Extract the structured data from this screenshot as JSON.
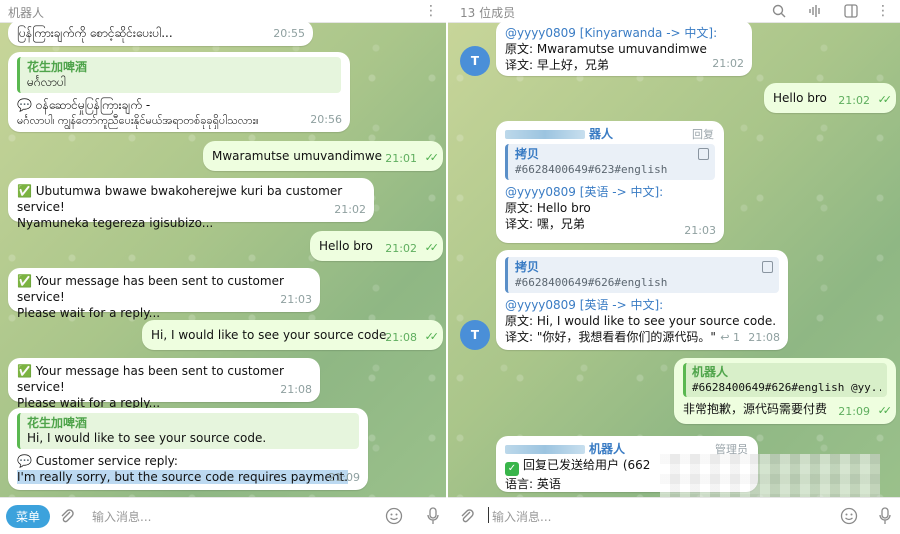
{
  "left": {
    "header": {
      "title": "机器人"
    },
    "messages": {
      "m0": {
        "text": "ပြန်ကြားချက်ကို စောင့်ဆိုင်းပေးပါ...",
        "time": "20:55"
      },
      "m1": {
        "quote_name": "花生加啤酒",
        "quote_text": "မင်္ဂလာပါ",
        "line1": "💬 ဝန်ဆောင်မှုပြန်ကြားချက် -",
        "line2": "မင်္ဂလာပါ၊ ကျွန်တော်ကူညီပေးနိုင်မယ်အရာတစ်ခုခုရှိပါသလား။",
        "time": "20:56"
      },
      "m2": {
        "text": "Mwaramutse umuvandimwe",
        "time": "21:01"
      },
      "m3": {
        "line1": "✅ Ubutumwa bwawe bwakoherejwe kuri ba customer service!",
        "line2": "Nyamuneka tegereza igisubizo...",
        "time": "21:02"
      },
      "m4": {
        "text": "Hello bro",
        "time": "21:02"
      },
      "m5": {
        "line1": "✅ Your message has been sent to customer service!",
        "line2": "Please wait for a reply...",
        "time": "21:03"
      },
      "m6": {
        "text": "Hi, I would like to see your source code.",
        "time": "21:08"
      },
      "m7": {
        "line1": "✅ Your message has been sent to customer service!",
        "line2": "Please wait for a reply...",
        "time": "21:08"
      },
      "m8": {
        "quote_name": "花生加啤酒",
        "quote_text": "Hi, I would like to see your source code.",
        "line1": "💬 Customer service reply:",
        "line2": "I'm really sorry, but the source code requires payment.",
        "time": "21:09"
      }
    },
    "bottom": {
      "menu": "菜单",
      "placeholder": "输入消息..."
    }
  },
  "right": {
    "header": {
      "title": "13 位成员"
    },
    "messages": {
      "r0": {
        "line0": "@yyyy0809 [Kinyarwanda -> 中文]:",
        "line1": "原文: Mwaramutse umuvandimwe",
        "line2": "译文: 早上好，兄弟",
        "time": "21:02"
      },
      "r1": {
        "text": "Hello bro",
        "time": "21:02"
      },
      "r2": {
        "sender": "器人",
        "reply": "回复",
        "quote_name": "拷贝",
        "quote_code": "#6628400649#623#english",
        "line0": "@yyyy0809 [英语 -> 中文]:",
        "line1": "原文: Hello bro",
        "line2": "译文: 嘿，兄弟",
        "time": "21:03"
      },
      "r3": {
        "quote_name": "拷贝",
        "quote_code": "#6628400649#626#english",
        "line0": "@yyyy0809 [英语 -> 中文]:",
        "line1": "原文: Hi, I would like to see your source code.",
        "line2": "译文: \"你好，我想看看你们的源代码。\"",
        "reply_count": "↩ 1",
        "time": "21:08"
      },
      "r4": {
        "quote_name": "机器人",
        "quote_code": "#6628400649#626#english @yy...",
        "line1": "非常抱歉，源代码需要付费",
        "time": "21:09"
      },
      "r5": {
        "sender": "机器人",
        "role": "管理员",
        "line1": "回复已发送给用户 (662",
        "line2": "语言: 英语"
      }
    },
    "avatar_letter": "T",
    "bottom": {
      "placeholder": "输入消息..."
    }
  }
}
